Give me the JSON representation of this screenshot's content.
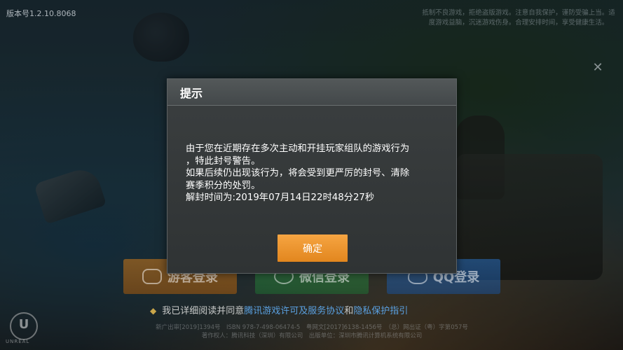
{
  "version": "版本号1.2.10.8068",
  "notice": "抵制不良游戏，拒绝盗版游戏。注意自我保护，谨防受骗上当。适度游戏益脑，沉迷游戏伤身。合理安排时间，享受健康生活。",
  "close_glyph": "✕",
  "dialog": {
    "title": "提示",
    "lines": [
      "由于您在近期存在多次主动和开挂玩家组队的游戏行为",
      "，特此封号警告。",
      "如果后续仍出现该行为，将会受到更严厉的封号、清除",
      "赛季积分的处罚。",
      "解封时间为:2019年07月14日22时48分27秒"
    ],
    "confirm_label": "确定"
  },
  "login": {
    "guest_label": "游客登录",
    "wechat_label": "微信登录",
    "qq_label": "QQ登录"
  },
  "agreement": {
    "mark": "◆",
    "prefix": "我已详细阅读并同意",
    "link1": "腾讯游戏许可及服务协议",
    "and": "和",
    "link2": "隐私保护指引"
  },
  "footer": {
    "line1": "新广出审[2019]1394号　ISBN 978-7-498-06474-5　粤网文[2017]6138-1456号　（总）网出证（粤）字第057号",
    "line2": "著作权人：腾讯科技（深圳）有限公司　出版单位：深圳市腾讯计算机系统有限公司"
  },
  "unreal": {
    "glyph": "U",
    "label": "UNREAL"
  },
  "colors": {
    "confirm": "#f09a32",
    "guest": "#d07a18",
    "wechat": "#349646",
    "qq": "#286ebe",
    "link": "#5aa0e0"
  }
}
